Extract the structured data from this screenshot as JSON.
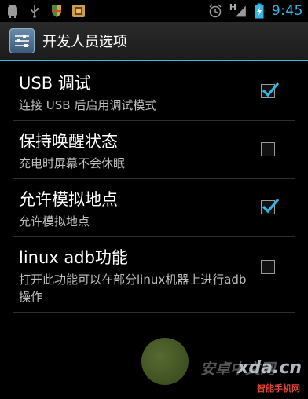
{
  "status_bar": {
    "icons_left": [
      "android-notification-icon",
      "usb-icon",
      "shield-icon",
      "app-icon"
    ],
    "icons_right": [
      "alarm-icon",
      "signal-icon",
      "battery-charging-icon"
    ],
    "network_type": "H",
    "time": "9:45",
    "accent_color": "#33b5e5"
  },
  "action_bar": {
    "icon": "settings-sliders-icon",
    "title": "开发人员选项"
  },
  "preferences": [
    {
      "title": "USB 调试",
      "summary": "连接 USB 后启用调试模式",
      "checked": true
    },
    {
      "title": "保持唤醒状态",
      "summary": "充电时屏幕不会休眠",
      "checked": false
    },
    {
      "title": "允许模拟地点",
      "summary": "允许模拟地点",
      "checked": true
    },
    {
      "title": "linux adb功能",
      "summary": "打开此功能可以在部分linux机器上进行adb操作",
      "checked": false
    }
  ],
  "watermark": {
    "text": "xda.cn",
    "subtext": "智能手机网",
    "cn_text": "安卓中文网"
  }
}
